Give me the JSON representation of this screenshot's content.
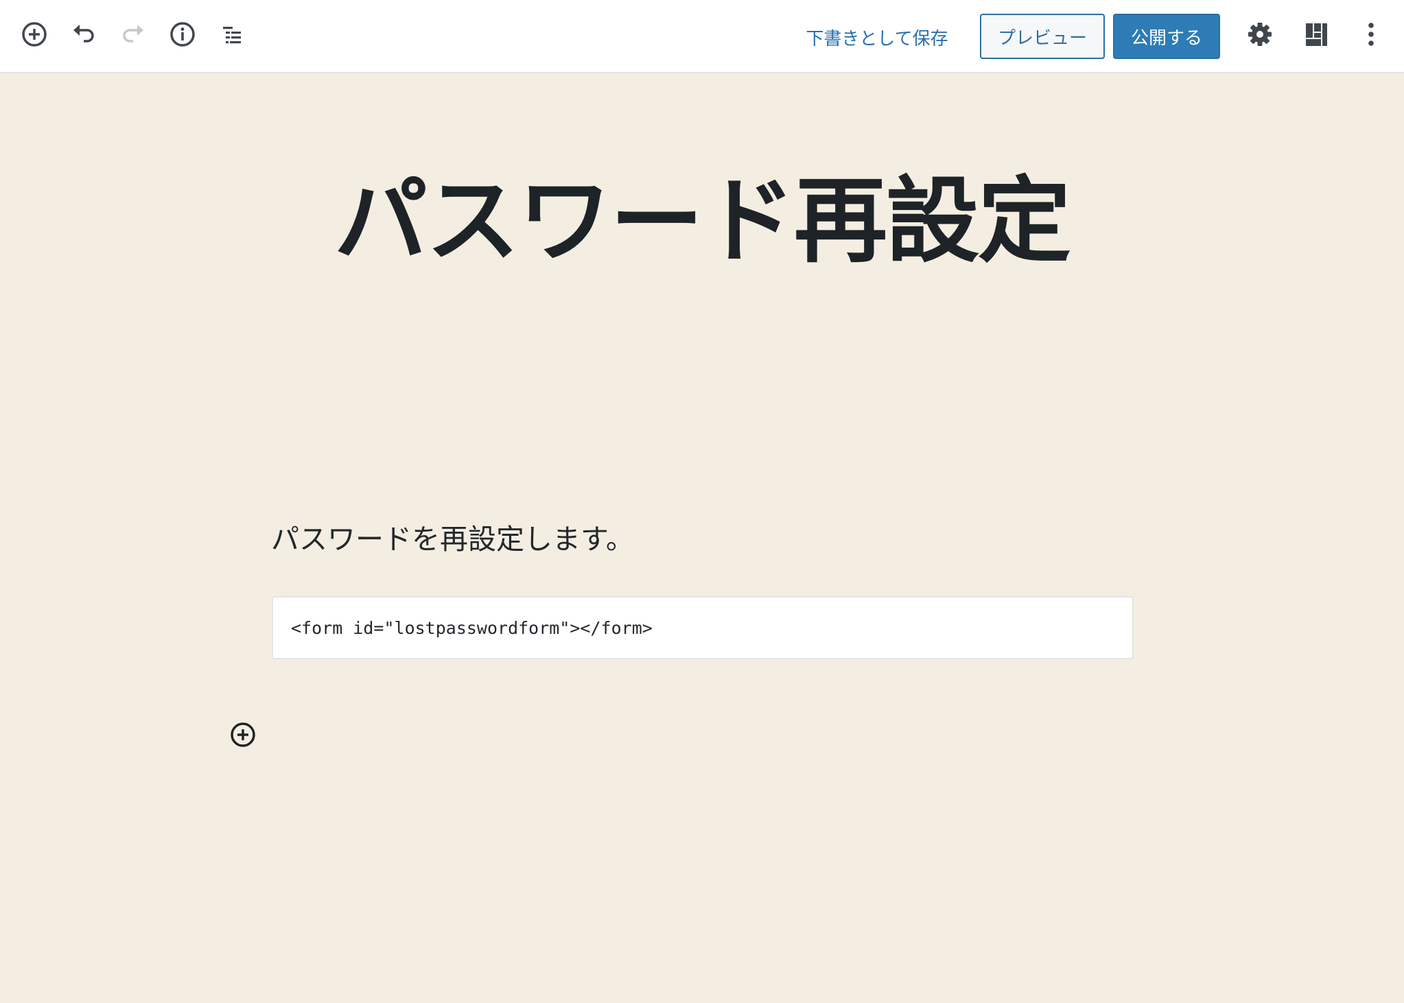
{
  "toolbar": {
    "icons": {
      "add": "plus-circle-icon",
      "undo": "undo-icon",
      "redo": "redo-icon",
      "info": "info-icon",
      "outline": "list-outline-icon",
      "settings": "gear-icon",
      "block_layout": "layout-icon",
      "more": "vertical-ellipsis-icon"
    },
    "save_draft_label": "下書きとして保存",
    "preview_label": "プレビュー",
    "publish_label": "公開する"
  },
  "editor": {
    "title": "パスワード再設定",
    "paragraph": "パスワードを再設定します。",
    "code": "<form id=\"lostpasswordform\"></form>"
  },
  "colors": {
    "canvas_bg": "#f4eee2",
    "primary": "#2d7cb6",
    "link": "#2a6fb0",
    "text": "#1e2327"
  }
}
